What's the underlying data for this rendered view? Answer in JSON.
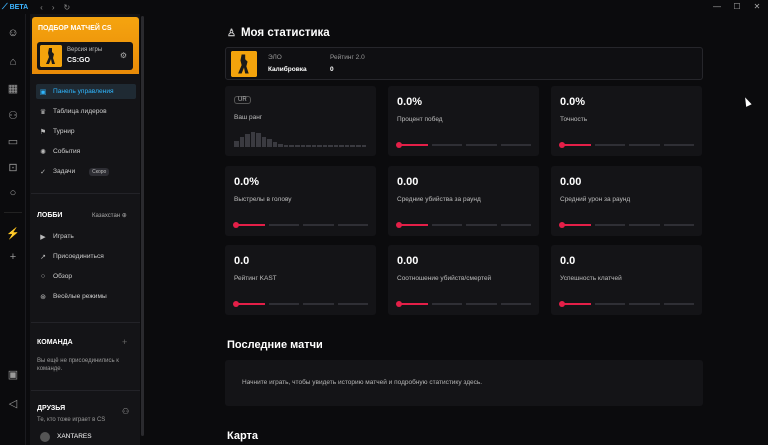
{
  "topbar": {
    "logo": "BETA",
    "back": "‹",
    "forward": "›",
    "refresh": "↻",
    "win_min": "—",
    "win_max": "☐",
    "win_close": "✕"
  },
  "sidebar": {
    "header_title": "ПОДБОР МАТЧЕЙ CS",
    "game_card": {
      "label": "Версия игры",
      "game": "CS:GO"
    },
    "menu": [
      {
        "label": "Панель управления",
        "icon": "dashboard-icon"
      },
      {
        "label": "Таблица лидеров",
        "icon": "trophy-icon"
      },
      {
        "label": "Турнир",
        "icon": "tournament-icon"
      },
      {
        "label": "События",
        "icon": "sun-icon"
      },
      {
        "label": "Задачи",
        "icon": "check-icon",
        "badge": "Скоро"
      }
    ],
    "lobby": {
      "title": "ЛОББИ",
      "region": "Казахстан",
      "items": [
        {
          "label": "Играть",
          "icon": "play-icon"
        },
        {
          "label": "Присоединиться",
          "icon": "join-icon"
        },
        {
          "label": "Обзор",
          "icon": "search-icon"
        },
        {
          "label": "Весёлые режимы",
          "icon": "fun-icon"
        }
      ]
    },
    "team": {
      "title": "КОМАНДА",
      "text": "Вы ещё не присоединились к команде."
    },
    "friends": {
      "title": "ДРУЗЬЯ",
      "subtitle": "Те, кто тоже играет в CS",
      "first_friend": "XANTARES"
    }
  },
  "main": {
    "title": "Моя статистика",
    "profile": {
      "elo_label": "ЭЛО",
      "elo_value": "Калибровка",
      "rating_label": "Рейтинг 2.0",
      "rating_value": "0"
    },
    "rank_card": {
      "badge": "UR",
      "label": "Ваш ранг",
      "histogram": [
        0.35,
        0.6,
        0.75,
        0.9,
        0.8,
        0.6,
        0.45,
        0.3,
        0.15,
        0.12,
        0.1,
        0.1,
        0.1,
        0.1,
        0.1,
        0.1,
        0.1,
        0.1,
        0.1,
        0.1,
        0.1,
        0.1,
        0.1,
        0.1
      ]
    },
    "stats": [
      {
        "value": "0.0%",
        "label": "Процент побед"
      },
      {
        "value": "0.0%",
        "label": "Точность"
      },
      {
        "value": "0.0%",
        "label": "Выстрелы в голову"
      },
      {
        "value": "0.00",
        "label": "Средние убийства за раунд"
      },
      {
        "value": "0.00",
        "label": "Средний урон за раунд"
      },
      {
        "value": "0.0",
        "label": "Рейтинг KAST"
      },
      {
        "value": "0.00",
        "label": "Соотношение убийств/смертей"
      },
      {
        "value": "0.0",
        "label": "Успешность клатчей"
      }
    ],
    "recent_title": "Последние матчи",
    "recent_empty": "Начните играть, чтобы увидеть историю матчей и подробную статистику здесь.",
    "map_title": "Карта"
  },
  "colors": {
    "accent": "#2fb7ff",
    "brand": "#f5a40f",
    "danger": "#e41f48"
  }
}
